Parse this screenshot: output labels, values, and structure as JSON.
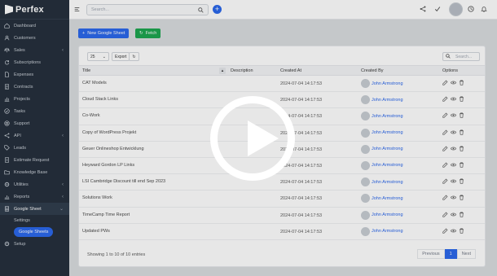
{
  "app": {
    "name": "Perfex"
  },
  "sidebar": {
    "items": [
      {
        "label": "Dashboard",
        "icon": "home-icon",
        "chev": false
      },
      {
        "label": "Customers",
        "icon": "user-icon",
        "chev": false
      },
      {
        "label": "Sales",
        "icon": "scale-icon",
        "chev": true
      },
      {
        "label": "Subscriptions",
        "icon": "refresh-icon",
        "chev": false
      },
      {
        "label": "Expenses",
        "icon": "file-icon",
        "chev": false
      },
      {
        "label": "Contracts",
        "icon": "contract-icon",
        "chev": false
      },
      {
        "label": "Projects",
        "icon": "chart-icon",
        "chev": false
      },
      {
        "label": "Tasks",
        "icon": "check-icon",
        "chev": false
      },
      {
        "label": "Support",
        "icon": "lifebuoy-icon",
        "chev": false
      },
      {
        "label": "API",
        "icon": "share-icon",
        "chev": true
      },
      {
        "label": "Leads",
        "icon": "tag-icon",
        "chev": false
      },
      {
        "label": "Estimate Request",
        "icon": "doc-icon",
        "chev": false
      },
      {
        "label": "Knowledge Base",
        "icon": "folder-icon",
        "chev": false
      },
      {
        "label": "Utilities",
        "icon": "gear-icon",
        "chev": true
      },
      {
        "label": "Reports",
        "icon": "bar-chart-icon",
        "chev": true
      },
      {
        "label": "Google Sheet",
        "icon": "sheet-icon",
        "chev": true
      }
    ],
    "sub_items": [
      {
        "label": "Settings"
      },
      {
        "label": "Google Sheets"
      }
    ],
    "setup": {
      "label": "Setup"
    }
  },
  "topbar": {
    "search_placeholder": "Search..."
  },
  "toolbar": {
    "new_label": "New Google Sheet",
    "fetch_label": "Fetch",
    "page_size": "25",
    "export_label": "Export",
    "table_search_placeholder": "Search..."
  },
  "table": {
    "headers": [
      "Title",
      "Description",
      "Created At",
      "Created By",
      "Options"
    ],
    "rows": [
      {
        "title": "CAT Models",
        "date": "2024-07-04 14:17:53",
        "by": "John Armstrong"
      },
      {
        "title": "Cloud Stack Links",
        "date": "2024-07-04 14:17:53",
        "by": "John Armstrong"
      },
      {
        "title": "Co-Work",
        "date": "2024-07-04 14:17:53",
        "by": "John Armstrong"
      },
      {
        "title": "Copy of WordPress Projekt",
        "date": "2024-07-04 14:17:53",
        "by": "John Armstrong"
      },
      {
        "title": "Geuer Onlineshop Entwicklung",
        "date": "2024-07-04 14:17:53",
        "by": "John Armstrong"
      },
      {
        "title": "Heyward Gordon LP Links",
        "date": "2024-07-04 14:17:53",
        "by": "John Armstrong"
      },
      {
        "title": "LSI Cambridge Discount till end Sep 2023",
        "date": "2024-07-04 14:17:53",
        "by": "John Armstrong"
      },
      {
        "title": "Solutions Work",
        "date": "2024-07-04 14:17:53",
        "by": "John Armstrong"
      },
      {
        "title": "TimeCamp Time Report",
        "date": "2024-07-04 14:17:53",
        "by": "John Armstrong"
      },
      {
        "title": "Updated PWs",
        "date": "2024-07-04 14:17:53",
        "by": "John Armstrong"
      }
    ],
    "footer": "Showing 1 to 10 of 10 entries",
    "pager": {
      "previous": "Previous",
      "current": "1",
      "next": "Next"
    }
  },
  "colors": {
    "accent": "#2563eb",
    "success": "#16a34a",
    "sidebar": "#1f2a37"
  }
}
